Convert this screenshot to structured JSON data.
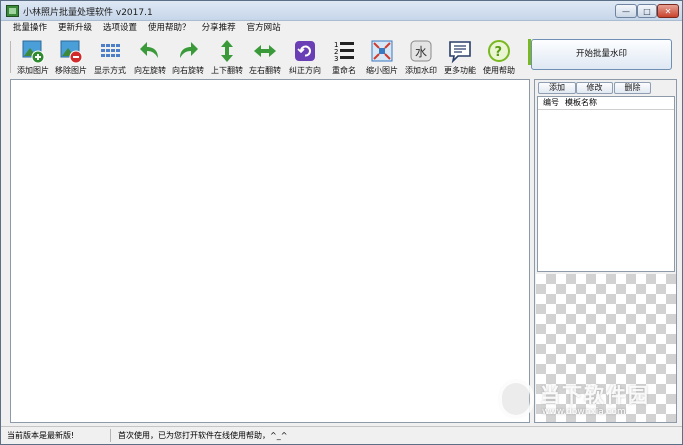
{
  "window": {
    "title": "小林照片批量处理软件 v2017.1",
    "controls": {
      "minimize": "—",
      "maximize": "□",
      "close": "✕"
    }
  },
  "menu": [
    "批量操作",
    "更新升级",
    "选项设置",
    "使用帮助？",
    "分享推荐",
    "官方网站"
  ],
  "toolbar": {
    "items": [
      {
        "label": "添加图片",
        "icon": "add-picture-icon"
      },
      {
        "label": "移除图片",
        "icon": "remove-picture-icon"
      },
      {
        "label": "显示方式",
        "icon": "display-mode-icon"
      },
      {
        "label": "向左旋转",
        "icon": "rotate-left-icon"
      },
      {
        "label": "向右旋转",
        "icon": "rotate-right-icon"
      },
      {
        "label": "上下翻转",
        "icon": "flip-vertical-icon"
      },
      {
        "label": "左右翻转",
        "icon": "flip-horizontal-icon"
      },
      {
        "label": "纠正方向",
        "icon": "correct-orientation-icon"
      },
      {
        "label": "重命名",
        "icon": "rename-icon"
      },
      {
        "label": "缩小图片",
        "icon": "shrink-picture-icon"
      },
      {
        "label": "添加水印",
        "icon": "add-watermark-icon"
      },
      {
        "label": "更多功能",
        "icon": "more-functions-icon"
      },
      {
        "label": "使用帮助",
        "icon": "help-icon"
      }
    ],
    "start_button": "开始批量水印"
  },
  "template_panel": {
    "buttons": {
      "add": "添加",
      "edit": "修改",
      "delete": "删除"
    },
    "columns": {
      "id": "编号",
      "name": "模板名称"
    }
  },
  "watermark": {
    "cn": "当下软件园",
    "en": "www.downxia.com"
  },
  "status": {
    "left": "当前版本是最新版!",
    "right": "首次使用，已为您打开软件在线使用帮助，^_^"
  },
  "colors": {
    "accent_green": "#2e8b2e",
    "accent_purple": "#6a3fb5",
    "help_green": "#7ab822"
  }
}
